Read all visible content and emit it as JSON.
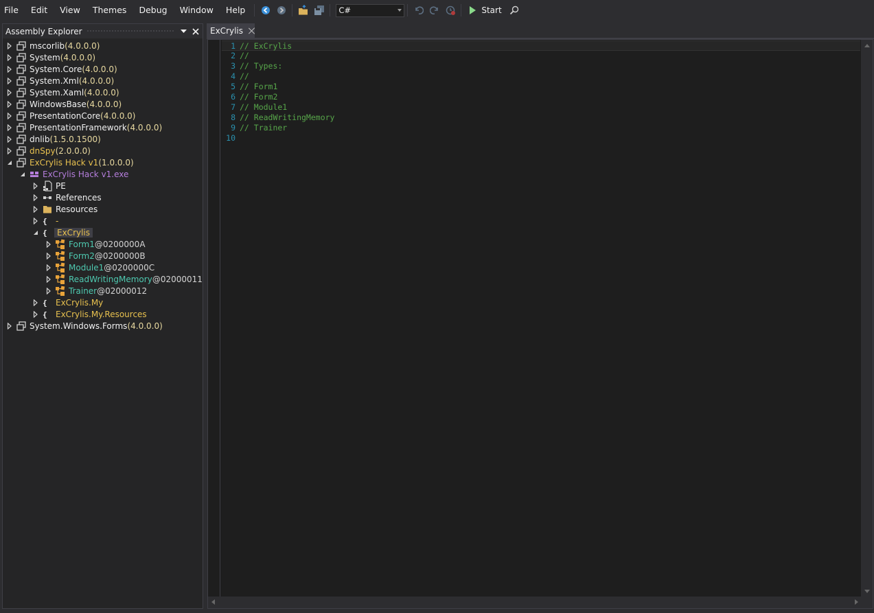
{
  "menu": {
    "items": [
      "File",
      "Edit",
      "View",
      "Themes",
      "Debug",
      "Window",
      "Help"
    ]
  },
  "toolbar": {
    "language": "C#",
    "start_label": "Start",
    "icons": [
      "back-icon",
      "forward-icon",
      "open-icon",
      "save-icon",
      "undo-icon",
      "redo-icon",
      "history-icon",
      "play-icon",
      "search-icon"
    ]
  },
  "explorer": {
    "title": "Assembly Explorer",
    "rows": [
      {
        "indent": 0,
        "toggle": "closed",
        "icon": "assembly-icon",
        "name": "mscorlib",
        "name_class": "lbl-white",
        "version": " (4.0.0.0)"
      },
      {
        "indent": 0,
        "toggle": "closed",
        "icon": "assembly-icon",
        "name": "System",
        "name_class": "lbl-white",
        "version": " (4.0.0.0)"
      },
      {
        "indent": 0,
        "toggle": "closed",
        "icon": "assembly-icon",
        "name": "System.Core",
        "name_class": "lbl-white",
        "version": " (4.0.0.0)"
      },
      {
        "indent": 0,
        "toggle": "closed",
        "icon": "assembly-icon",
        "name": "System.Xml",
        "name_class": "lbl-white",
        "version": " (4.0.0.0)"
      },
      {
        "indent": 0,
        "toggle": "closed",
        "icon": "assembly-icon",
        "name": "System.Xaml",
        "name_class": "lbl-white",
        "version": " (4.0.0.0)"
      },
      {
        "indent": 0,
        "toggle": "closed",
        "icon": "assembly-icon",
        "name": "WindowsBase",
        "name_class": "lbl-white",
        "version": " (4.0.0.0)"
      },
      {
        "indent": 0,
        "toggle": "closed",
        "icon": "assembly-icon",
        "name": "PresentationCore",
        "name_class": "lbl-white",
        "version": " (4.0.0.0)"
      },
      {
        "indent": 0,
        "toggle": "closed",
        "icon": "assembly-icon",
        "name": "PresentationFramework",
        "name_class": "lbl-white",
        "version": " (4.0.0.0)"
      },
      {
        "indent": 0,
        "toggle": "closed",
        "icon": "assembly-icon",
        "name": "dnlib",
        "name_class": "lbl-white",
        "version": " (1.5.0.1500)"
      },
      {
        "indent": 0,
        "toggle": "closed",
        "icon": "assembly-icon",
        "name": "dnSpy",
        "name_class": "lbl-yellow",
        "version": " (2.0.0.0)"
      },
      {
        "indent": 0,
        "toggle": "open",
        "icon": "assembly-icon",
        "name": "ExCrylis Hack v1",
        "name_class": "lbl-yellow",
        "version": " (1.0.0.0)"
      },
      {
        "indent": 1,
        "toggle": "open",
        "icon": "module-icon",
        "name": "ExCrylis Hack v1.exe",
        "name_class": "lbl-purple",
        "version": ""
      },
      {
        "indent": 2,
        "toggle": "closed",
        "icon": "pe-icon",
        "name": "PE",
        "name_class": "lbl-white",
        "version": ""
      },
      {
        "indent": 2,
        "toggle": "closed",
        "icon": "references-icon",
        "name": "References",
        "name_class": "lbl-white",
        "version": ""
      },
      {
        "indent": 2,
        "toggle": "closed",
        "icon": "folder-icon",
        "name": "Resources",
        "name_class": "lbl-white",
        "version": ""
      },
      {
        "indent": 2,
        "toggle": "closed",
        "icon": "namespace-icon",
        "name": "-",
        "name_class": "lbl-yellow",
        "version": ""
      },
      {
        "indent": 2,
        "toggle": "open",
        "icon": "namespace-icon",
        "name": "ExCrylis",
        "name_class": "lbl-yellow",
        "version": "",
        "selected": true
      },
      {
        "indent": 3,
        "toggle": "closed",
        "icon": "class-icon",
        "name": "Form1",
        "name_class": "lbl-teal",
        "version": " @0200000A"
      },
      {
        "indent": 3,
        "toggle": "closed",
        "icon": "class-icon",
        "name": "Form2",
        "name_class": "lbl-teal",
        "version": " @0200000B"
      },
      {
        "indent": 3,
        "toggle": "closed",
        "icon": "class-icon",
        "name": "Module1",
        "name_class": "lbl-teal",
        "version": " @0200000C"
      },
      {
        "indent": 3,
        "toggle": "closed",
        "icon": "class-icon",
        "name": "ReadWritingMemory",
        "name_class": "lbl-teal",
        "version": " @02000011"
      },
      {
        "indent": 3,
        "toggle": "closed",
        "icon": "class-icon",
        "name": "Trainer",
        "name_class": "lbl-teal",
        "version": " @02000012"
      },
      {
        "indent": 2,
        "toggle": "closed",
        "icon": "namespace-icon",
        "name": "ExCrylis.My",
        "name_class": "lbl-yellow",
        "version": ""
      },
      {
        "indent": 2,
        "toggle": "closed",
        "icon": "namespace-icon",
        "name": "ExCrylis.My.Resources",
        "name_class": "lbl-yellow",
        "version": ""
      },
      {
        "indent": 0,
        "toggle": "closed",
        "icon": "assembly-icon",
        "name": "System.Windows.Forms",
        "name_class": "lbl-white",
        "version": " (4.0.0.0)"
      }
    ]
  },
  "editor": {
    "tab_label": "ExCrylis",
    "lines": [
      {
        "num": "1",
        "text": "// ExCrylis"
      },
      {
        "num": "2",
        "text": "//"
      },
      {
        "num": "3",
        "text": "// Types:"
      },
      {
        "num": "4",
        "text": "//"
      },
      {
        "num": "5",
        "text": "// Form1"
      },
      {
        "num": "6",
        "text": "// Form2"
      },
      {
        "num": "7",
        "text": "// Module1"
      },
      {
        "num": "8",
        "text": "// ReadWritingMemory"
      },
      {
        "num": "9",
        "text": "// Trainer"
      },
      {
        "num": "10",
        "text": ""
      }
    ]
  },
  "colors": {
    "background": "#2d2d30",
    "editor_bg": "#1e1e1e",
    "comment": "#57a64a",
    "line_number": "#2b91af",
    "namespace_yellow": "#e8c14f",
    "class_teal": "#4ec9b0",
    "module_purple": "#b57edc"
  }
}
